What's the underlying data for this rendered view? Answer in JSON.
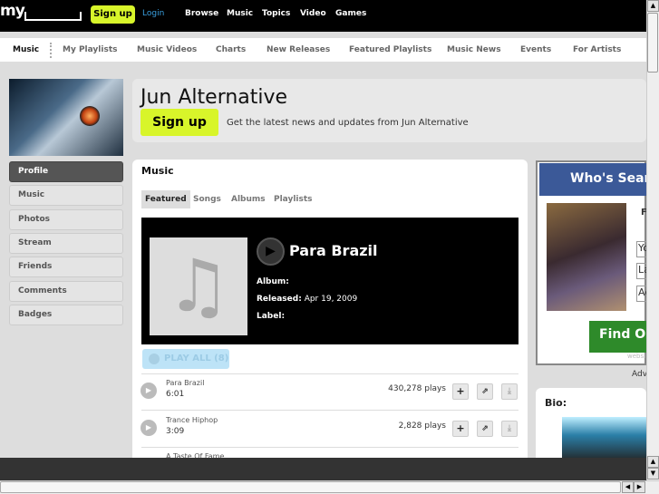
{
  "topbar": {
    "logo": "my",
    "signup": "Sign up",
    "login": "Login",
    "nav": [
      "Browse",
      "Music",
      "Topics",
      "Video",
      "Games"
    ]
  },
  "subnav": [
    "Music",
    "My Playlists",
    "Music Videos",
    "Charts",
    "New Releases",
    "Featured Playlists",
    "Music News",
    "Events",
    "For Artists"
  ],
  "header": {
    "title": "Jun Alternative",
    "signup": "Sign up",
    "tagline": "Get the latest news and updates from Jun Alternative"
  },
  "sidebar": [
    "Profile",
    "Music",
    "Photos",
    "Stream",
    "Friends",
    "Comments",
    "Badges"
  ],
  "music": {
    "title": "Music",
    "tabs": [
      "Featured",
      "Songs",
      "Albums",
      "Playlists"
    ],
    "featured": {
      "label": "",
      "title": "Para Brazil",
      "album_label": "Album:",
      "album": "",
      "released_label": "Released:",
      "released": "Apr 19, 2009",
      "label_label": "Label:"
    },
    "play_all": "PLAY ALL (8)",
    "tracks": [
      {
        "title": "Para Brazil",
        "duration": "6:01",
        "plays": "430,278 plays"
      },
      {
        "title": "Trance Hiphop",
        "duration": "3:09",
        "plays": "2,828 plays"
      },
      {
        "title": "A Taste Of Fame",
        "duration": "",
        "plays": ""
      }
    ]
  },
  "ad": {
    "headline": "Who's Sear",
    "f": "F",
    "inputs": [
      "Yo",
      "La",
      "Ag"
    ],
    "button": "Find Ou",
    "web": "websi",
    "adv": "Adv"
  },
  "bio": {
    "title": "Bio:"
  },
  "colors": {
    "accent": "#d8f52a",
    "featured": "#e89a20",
    "ad_blue": "#3b5998"
  }
}
